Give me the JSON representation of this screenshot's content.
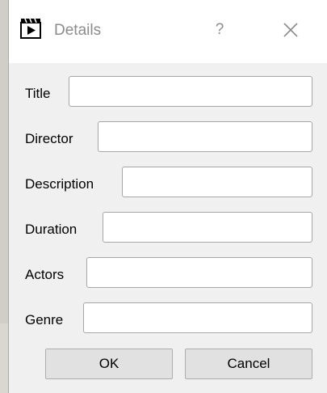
{
  "window": {
    "title": "Details",
    "help_glyph": "?",
    "icon": "film-clapper-icon",
    "close_icon": "close-icon"
  },
  "form": {
    "fields": [
      {
        "label": "Title",
        "value": ""
      },
      {
        "label": "Director",
        "value": ""
      },
      {
        "label": "Description",
        "value": ""
      },
      {
        "label": "Duration",
        "value": ""
      },
      {
        "label": "Actors",
        "value": ""
      },
      {
        "label": "Genre",
        "value": ""
      }
    ]
  },
  "buttons": {
    "ok_label": "OK",
    "cancel_label": "Cancel"
  },
  "colors": {
    "window_bg": "#f0f0f0",
    "titlebar_bg": "#ffffff",
    "title_text": "#8c8c8c",
    "field_border": "#a6a6a6",
    "button_bg": "#e1e1e1"
  }
}
